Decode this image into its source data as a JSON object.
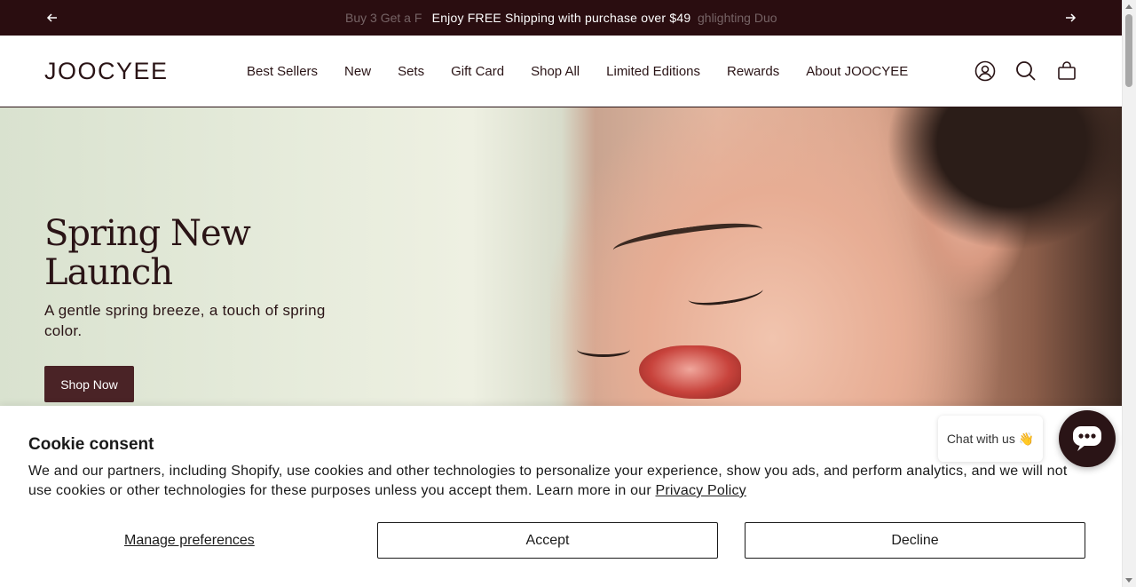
{
  "announcement": {
    "message": "Enjoy FREE Shipping with purchase over $49",
    "ghost_left": "Buy 3 Get a F",
    "ghost_right": "ghlighting Duo",
    "prev_icon": "arrow-left-icon",
    "next_icon": "arrow-right-icon"
  },
  "header": {
    "logo": "JOOCYEE",
    "nav": [
      "Best Sellers",
      "New",
      "Sets",
      "Gift Card",
      "Shop All",
      "Limited Editions",
      "Rewards",
      "About JOOCYEE"
    ],
    "icons": [
      "account-icon",
      "search-icon",
      "cart-icon"
    ]
  },
  "hero": {
    "title_line1": "Spring New",
    "title_line2": "Launch",
    "subtitle": "A gentle spring breeze, a touch of spring color.",
    "cta": "Shop Now"
  },
  "cookie": {
    "title": "Cookie consent",
    "text": "We and our partners, including Shopify, use cookies and other technologies to personalize your experience, show you ads, and perform analytics, and we will not use cookies or other technologies for these purposes unless you accept them. Learn more in our ",
    "link": "Privacy Policy",
    "manage": "Manage preferences",
    "accept": "Accept",
    "decline": "Decline"
  },
  "chat": {
    "label": "Chat with us 👋",
    "icon": "chat-bubble-icon"
  },
  "colors": {
    "brand_dark": "#2a0d10",
    "button": "#4a2326",
    "text": "#2a1416"
  }
}
